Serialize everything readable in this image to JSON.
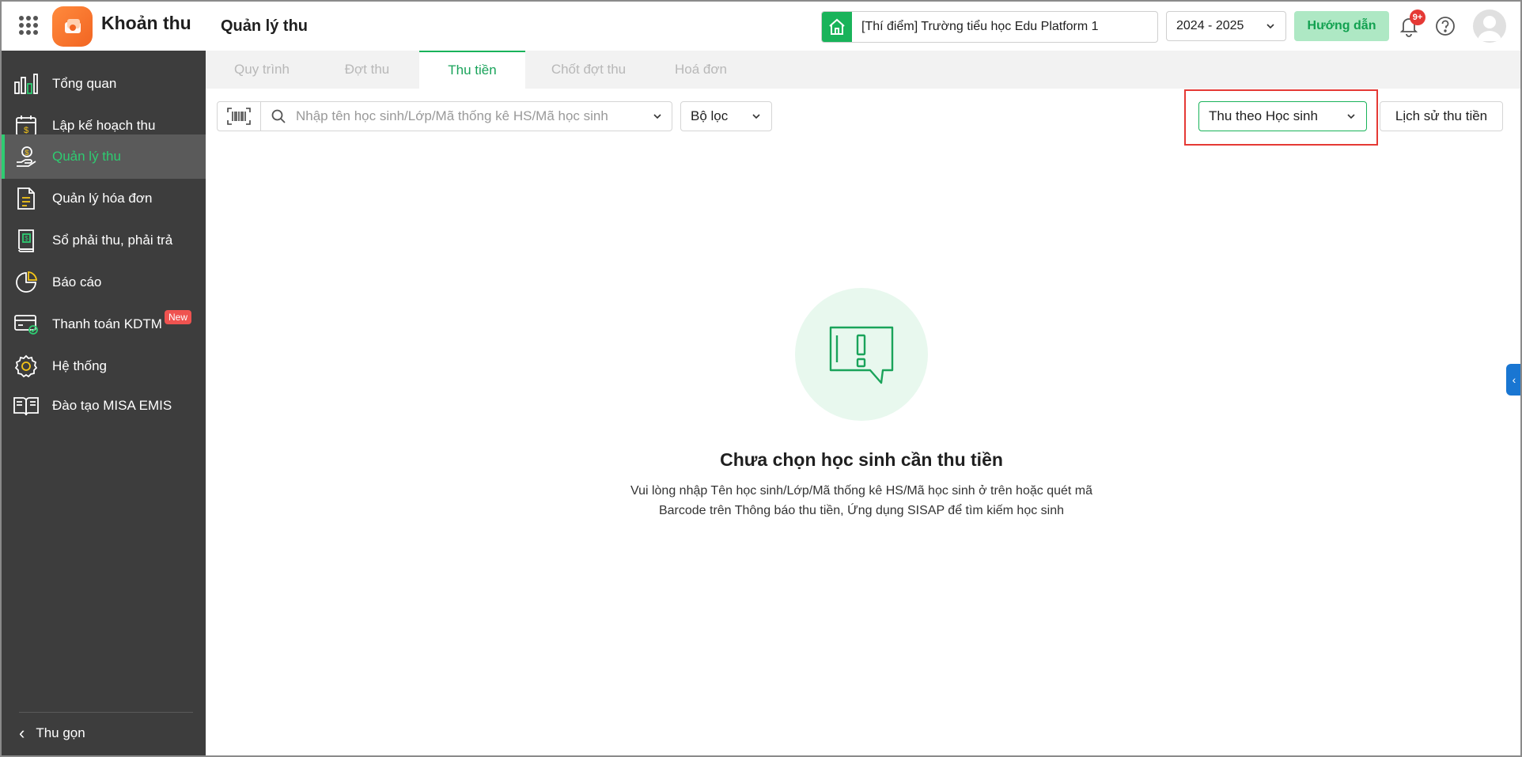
{
  "header": {
    "app_name": "Khoản thu",
    "page_title": "Quản lý thu",
    "school": "[Thí điểm] Trường tiểu học Edu Platform 1",
    "year": "2024 - 2025",
    "guide_label": "Hướng dẫn",
    "notification_count": "9+"
  },
  "sidebar": {
    "items": [
      {
        "label": "Tổng quan",
        "icon": "bar-chart-icon"
      },
      {
        "label": "Lập kế hoạch thu",
        "icon": "calendar-dollar-icon"
      },
      {
        "label": "Quản lý thu",
        "icon": "hand-coin-icon",
        "active": true
      },
      {
        "label": "Quản lý hóa đơn",
        "icon": "invoice-icon"
      },
      {
        "label": "Sổ phải thu, phải trả",
        "icon": "ledger-icon"
      },
      {
        "label": "Báo cáo",
        "icon": "pie-chart-icon"
      },
      {
        "label": "Thanh toán KDTM",
        "icon": "card-check-icon",
        "badge": "New"
      },
      {
        "label": "Hệ thống",
        "icon": "gear-icon"
      },
      {
        "label": "Đào tạo MISA EMIS",
        "icon": "book-icon"
      }
    ],
    "collapse_label": "Thu gọn"
  },
  "tabs": [
    {
      "label": "Quy trình"
    },
    {
      "label": "Đợt thu"
    },
    {
      "label": "Thu tiền",
      "active": true
    },
    {
      "label": "Chốt đợt thu"
    },
    {
      "label": "Hoá đơn"
    }
  ],
  "toolbar": {
    "search_placeholder": "Nhập tên học sinh/Lớp/Mã thống kê HS/Mã học sinh",
    "filter_label": "Bộ lọc",
    "mode_label": "Thu theo Học sinh",
    "history_label": "Lịch sử thu tiền"
  },
  "empty_state": {
    "title": "Chưa chọn học sinh cần thu tiền",
    "line1": "Vui lòng nhập Tên học sinh/Lớp/Mã thống kê HS/Mã học sinh ở trên hoặc quét mã",
    "line2": "Barcode trên Thông báo thu tiền, Ứng dụng SISAP để tìm kiếm học sinh"
  },
  "colors": {
    "accent": "#19b35a",
    "sidebar_bg": "#3d3d3d",
    "highlight": "#e53935"
  }
}
